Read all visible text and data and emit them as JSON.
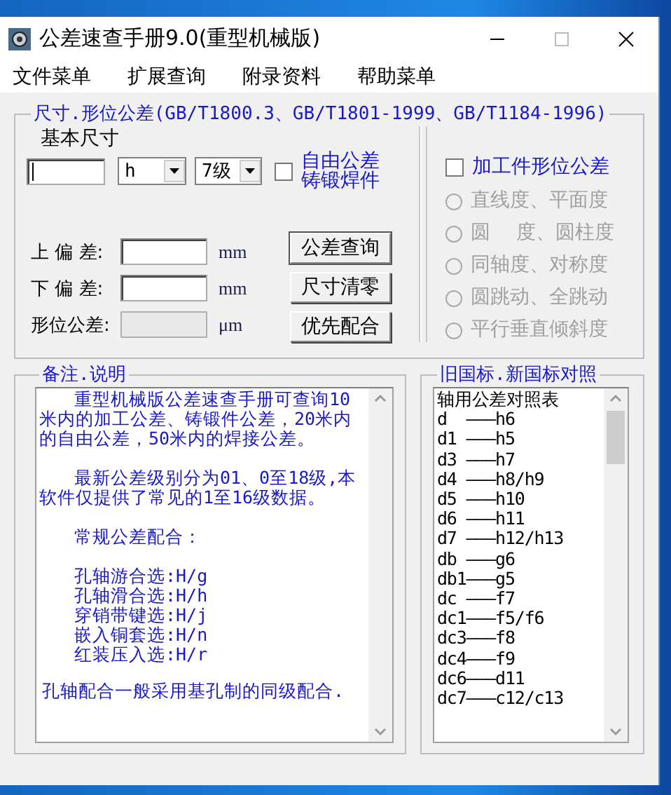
{
  "window": {
    "title": "公差速查手册9.0(重型机械版)"
  },
  "menu": [
    "文件菜单",
    "扩展查询",
    "附录资料",
    "帮助菜单"
  ],
  "size_group": {
    "title": "尺寸.形位公差(GB/T1800.3、GB/T1801-1999、GB/T1184-1996)",
    "basic_size_label": "基本尺寸",
    "basic_size_input": {
      "focused": true
    },
    "fit_select": {
      "value": "h"
    },
    "grade_select": {
      "value": "7级"
    },
    "free_tolerance": {
      "label": "自由公差铸锻焊件",
      "checked": false
    },
    "fields": [
      {
        "label": "上 偏 差:",
        "unit": "mm",
        "disabled": false
      },
      {
        "label": "下 偏 差:",
        "unit": "mm",
        "disabled": false
      },
      {
        "label": "形位公差:",
        "unit": "μm",
        "disabled": true
      }
    ],
    "buttons": [
      {
        "label": "公差查询",
        "default": true
      },
      {
        "label": "尺寸清零",
        "default": false
      },
      {
        "label": "优先配合",
        "default": false
      }
    ]
  },
  "form_group": {
    "checkbox": {
      "label": "加工件形位公差",
      "checked": false
    },
    "options": [
      {
        "label": "直线度、平面度",
        "selected": false,
        "disabled": true
      },
      {
        "label": "圆　 度、圆柱度",
        "selected": false,
        "disabled": true
      },
      {
        "label": "同轴度、对称度",
        "selected": false,
        "disabled": true
      },
      {
        "label": "圆跳动、全跳动",
        "selected": false,
        "disabled": true
      },
      {
        "label": "平行垂直倾斜度",
        "selected": false,
        "disabled": true
      }
    ]
  },
  "notes_group": {
    "title": "备注.说明",
    "paragraphs": [
      {
        "kind": "indent",
        "text": "重型机械版公差速查手册可查询10米内的加工公差、铸锻件公差，20米内的自由公差，50米内的焊接公差。"
      },
      {
        "kind": "indent",
        "text": "最新公差级别分为01、0至18级,本软件仅提供了常见的1至16级数据。"
      },
      {
        "kind": "indent",
        "text": "常规公差配合："
      },
      {
        "kind": "tight",
        "text": "孔轴游合选:H/g"
      },
      {
        "kind": "tight",
        "text": "孔轴滑合选:H/h"
      },
      {
        "kind": "tight",
        "text": "穿销带键选:H/j"
      },
      {
        "kind": "tight",
        "text": "嵌入铜套选:H/n"
      },
      {
        "kind": "tight",
        "text": "红装压入选:H/r"
      },
      {
        "kind": "plain",
        "text": "孔轴配合一般采用基孔制的同级配合."
      }
    ]
  },
  "standards_group": {
    "title": "旧国标.新国标对照",
    "items": [
      "轴用公差对照表",
      "d  ———h6",
      "d1 ———h5",
      "d3 ———h7",
      "d4 ———h8/h9",
      "d5 ———h10",
      "d6 ———h11",
      "d7 ———h12/h13",
      "db ———g6",
      "db1———g5",
      "dc ———f7",
      "dc1———f5/f6",
      "dc3———f8",
      "dc4———f9",
      "dc6———d11",
      "dc7———c12/c13"
    ]
  }
}
